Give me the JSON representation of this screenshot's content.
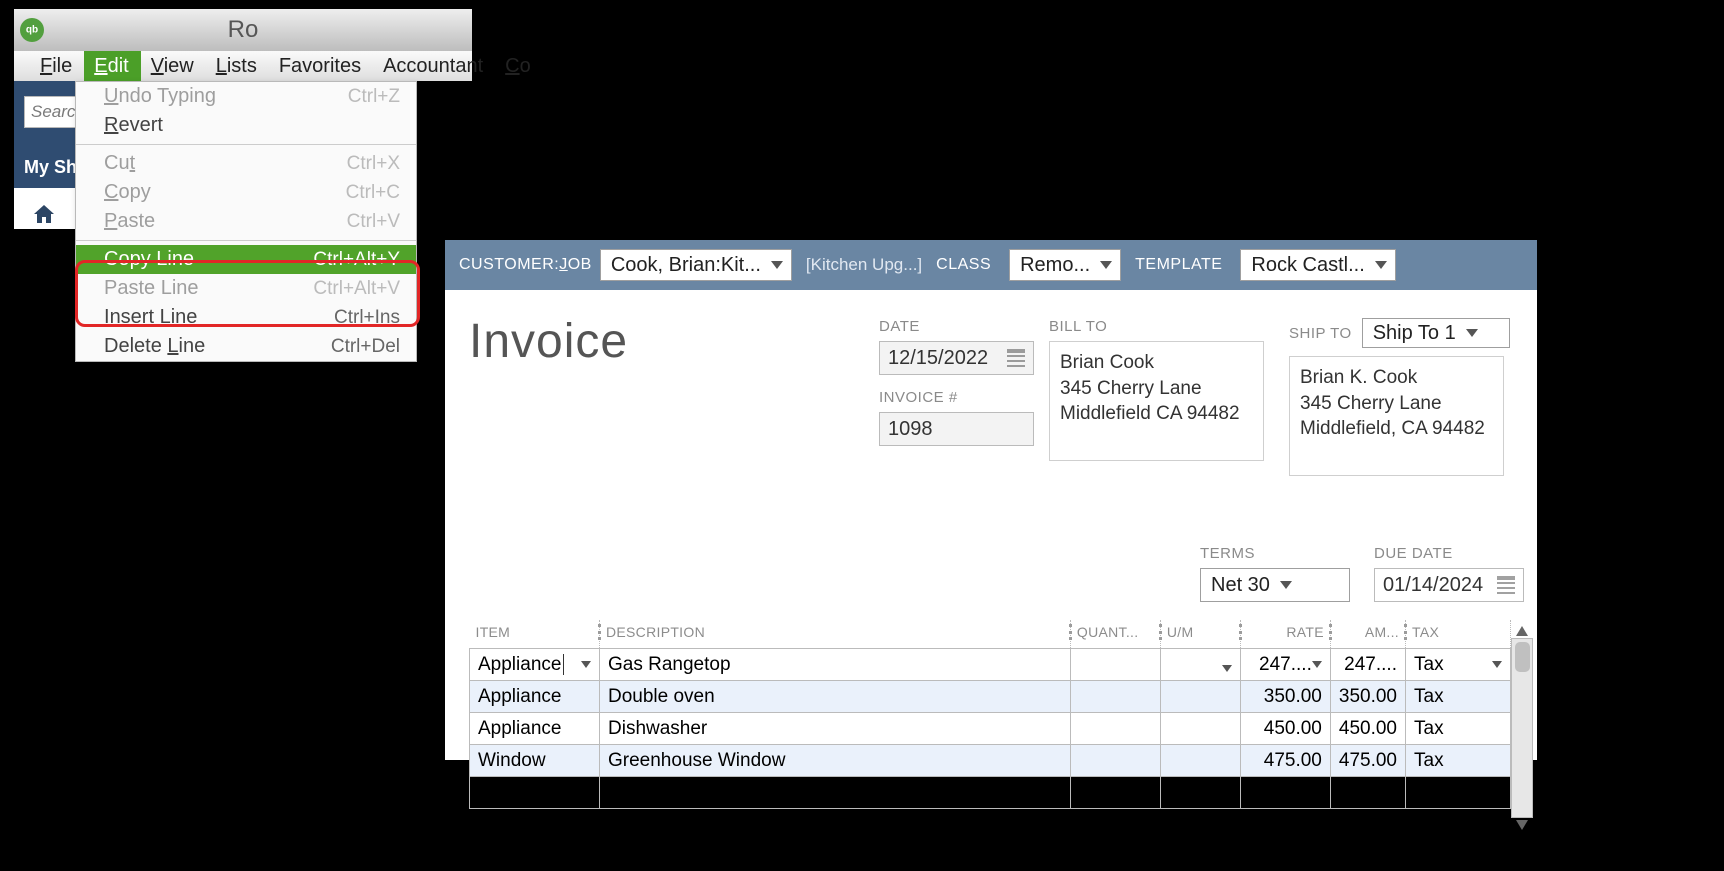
{
  "titlebar": {
    "text": "Ro"
  },
  "menubar": {
    "file": "File",
    "edit": "Edit",
    "view": "View",
    "lists": "Lists",
    "favorites": "Favorites",
    "accountant": "Accountant",
    "co": "Co"
  },
  "toolbar": {
    "search_placeholder": "Searcl",
    "my_shortcuts": "My Sh"
  },
  "edit_menu": {
    "undo": "Undo Typing",
    "undo_k": "Ctrl+Z",
    "revert": "Revert",
    "cut": "Cut",
    "cut_k": "Ctrl+X",
    "copy": "Copy",
    "copy_k": "Ctrl+C",
    "paste": "Paste",
    "paste_k": "Ctrl+V",
    "copyline": "Copy Line",
    "copyline_k": "Ctrl+Alt+Y",
    "pasteline": "Paste Line",
    "pasteline_k": "Ctrl+Alt+V",
    "insertline": "Insert Line",
    "insertline_k": "Ctrl+Ins",
    "deleteline": "Delete Line",
    "deleteline_k": "Ctrl+Del"
  },
  "inv_header": {
    "custjob_lbl": "CUSTOMER:JOB",
    "custjob": "Cook, Brian:Kit...",
    "jobname": "[Kitchen Upg...]",
    "class_lbl": "CLASS",
    "class": "Remo...",
    "template_lbl": "TEMPLATE",
    "template": "Rock Castl..."
  },
  "invoice": {
    "title": "Invoice",
    "date_lbl": "DATE",
    "date": "12/15/2022",
    "num_lbl": "INVOICE #",
    "num": "1098",
    "billto_lbl": "BILL TO",
    "billto": "Brian Cook\n345 Cherry Lane\nMiddlefield CA 94482",
    "shipto_lbl": "SHIP TO",
    "shipto_sel": "Ship To 1",
    "shipto": "Brian K. Cook\n345 Cherry Lane\nMiddlefield, CA 94482",
    "terms_lbl": "TERMS",
    "terms": "Net 30",
    "duedate_lbl": "DUE DATE",
    "duedate": "01/14/2024"
  },
  "columns": {
    "item": "ITEM",
    "desc": "DESCRIPTION",
    "qty": "QUANT...",
    "um": "U/M",
    "rate": "RATE",
    "amt": "AM...",
    "tax": "TAX"
  },
  "lines": [
    {
      "item": "Appliance",
      "desc": "Gas Rangetop",
      "rate": "247....",
      "amt": "247....",
      "tax": "Tax",
      "active": true
    },
    {
      "item": "Appliance",
      "desc": "Double oven",
      "rate": "350.00",
      "amt": "350.00",
      "tax": "Tax"
    },
    {
      "item": "Appliance",
      "desc": "Dishwasher",
      "rate": "450.00",
      "amt": "450.00",
      "tax": "Tax"
    },
    {
      "item": "Window",
      "desc": "Greenhouse Window",
      "rate": "475.00",
      "amt": "475.00",
      "tax": "Tax"
    }
  ]
}
